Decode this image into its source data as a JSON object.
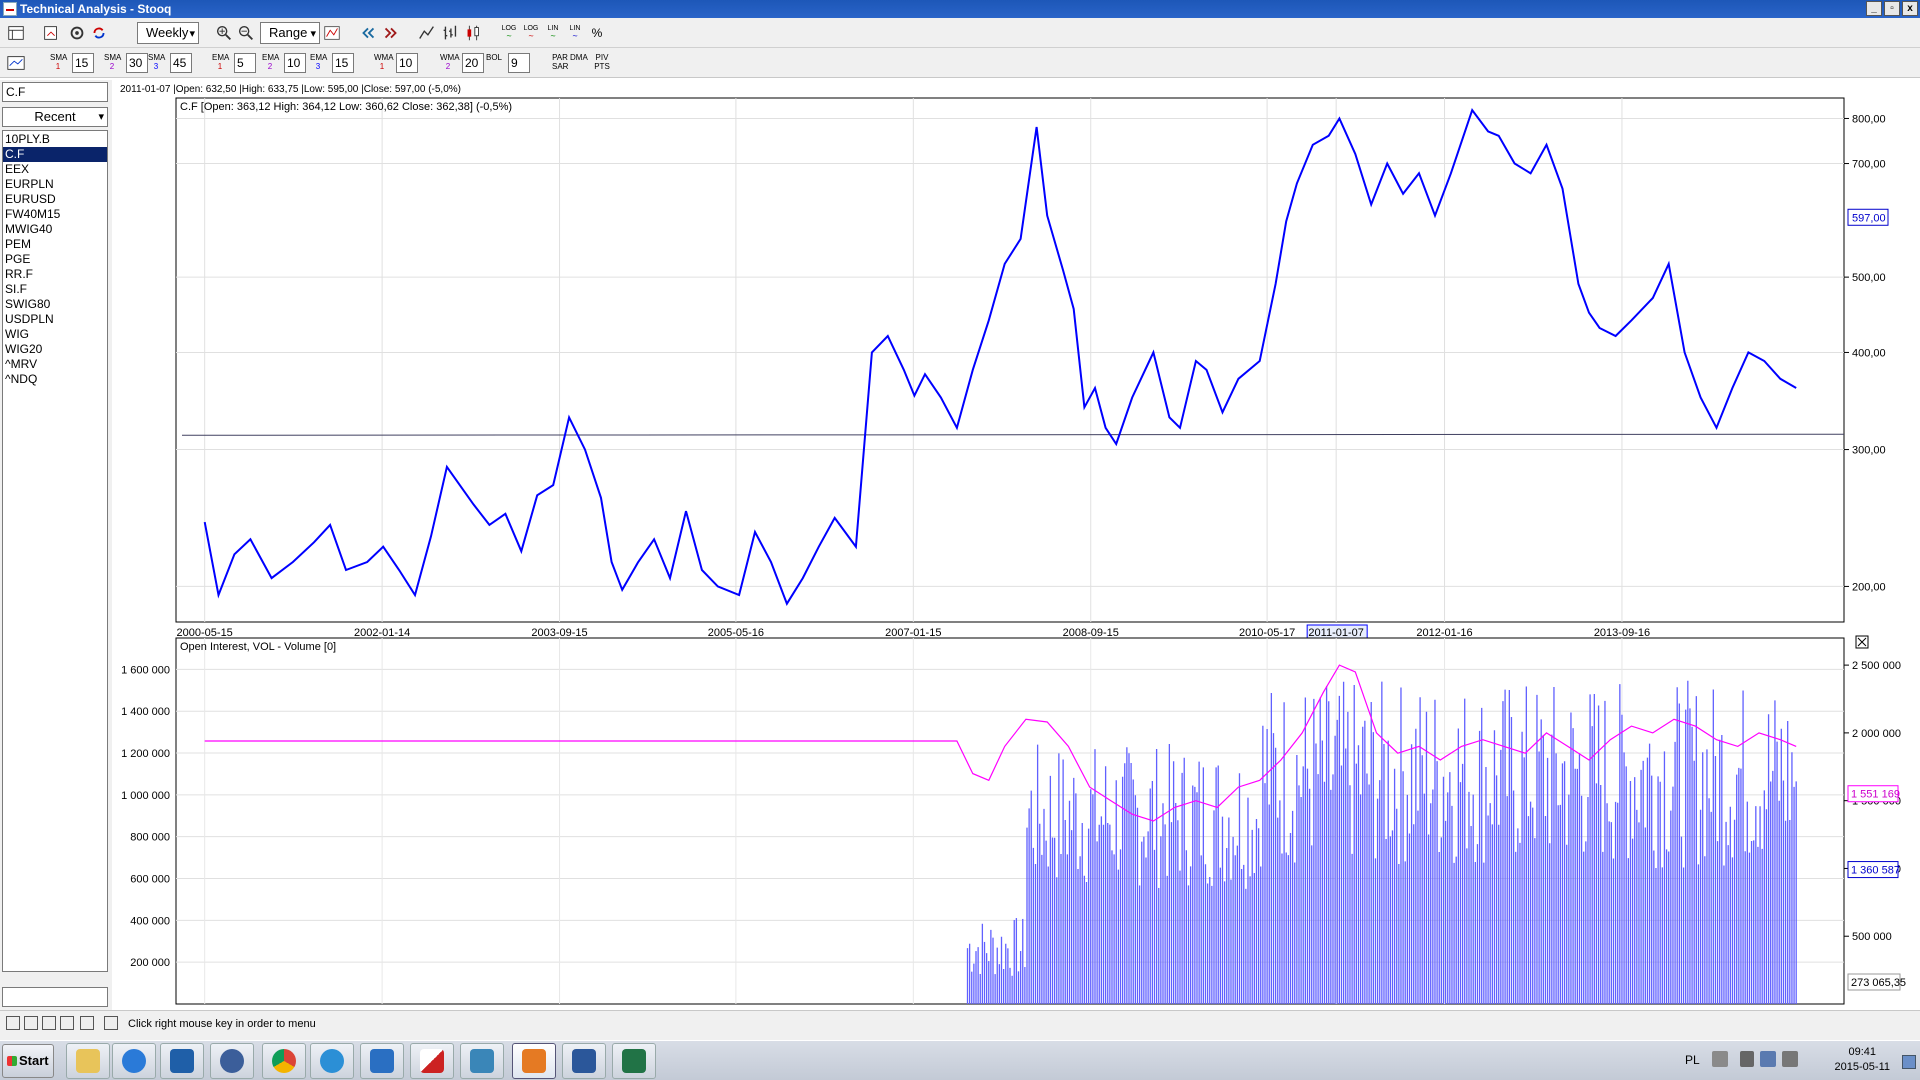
{
  "window": {
    "title": "Technical Analysis - Stooq",
    "buttons": [
      "_",
      "▫",
      "x"
    ]
  },
  "toolbar": {
    "interval": "Weekly",
    "range": "Range",
    "scale_buttons": [
      "LOG",
      "LOG",
      "LIN",
      "LIN",
      "%"
    ]
  },
  "indicators": [
    {
      "name": "SMA",
      "index": "1",
      "value": "15",
      "color": "#cc0000"
    },
    {
      "name": "SMA",
      "index": "2",
      "value": "30",
      "color": "#9900cc"
    },
    {
      "name": "SMA",
      "index": "3",
      "value": "45",
      "color": "#0000ff"
    },
    {
      "name": "EMA",
      "index": "1",
      "value": "5",
      "color": "#cc0000"
    },
    {
      "name": "EMA",
      "index": "2",
      "value": "10",
      "color": "#9900cc"
    },
    {
      "name": "EMA",
      "index": "3",
      "value": "15",
      "color": "#0000ff"
    },
    {
      "name": "WMA",
      "index": "1",
      "value": "10",
      "color": "#cc0000"
    },
    {
      "name": "WMA",
      "index": "2",
      "value": "20",
      "color": "#9900cc"
    },
    {
      "name": "BOL",
      "index": "",
      "value": "9",
      "color": "#000000"
    },
    {
      "name": "PAR SAR",
      "index": "",
      "value": "",
      "color": "#000000"
    },
    {
      "name": "DMA",
      "index": "",
      "value": "",
      "color": "#000000"
    },
    {
      "name": "PIV PTS",
      "index": "",
      "value": "",
      "color": "#000000"
    }
  ],
  "sidebar": {
    "symbol": "C.F",
    "recent": "Recent",
    "symbols": [
      "10PLY.B",
      "C.F",
      "EEX",
      "EURPLN",
      "EURUSD",
      "FW40M15",
      "MWIG40",
      "PEM",
      "PGE",
      "RR.F",
      "SI.F",
      "SWIG80",
      "USDPLN",
      "WIG",
      "WIG20",
      "^MRV",
      "^NDQ"
    ],
    "selected": "C.F"
  },
  "infoline": "2011-01-07 |Open: 632,50 |High: 633,75 |Low: 595,00 |Close: 597,00 (-5,0%)",
  "chart_data": [
    {
      "type": "line",
      "title": "C.F [Open: 363,12  High: 364,12  Low: 360,62  Close: 362,38] (-0,5%)",
      "y_scale": "log",
      "ylim": [
        180,
        850
      ],
      "y_ticks": [
        "800,00",
        "700,00",
        "500,00",
        "400,00",
        "300,00",
        "200,00"
      ],
      "y_tick_values": [
        800,
        700,
        500,
        400,
        300,
        200
      ],
      "current_value": "597,00",
      "x_ticks": [
        "2000-05-15",
        "2002-01-14",
        "2003-09-15",
        "2005-05-16",
        "2007-01-15",
        "2008-09-15",
        "2010-05-17",
        "2011-01-07",
        "2012-01-16",
        "2013-09-16"
      ],
      "x_tick_values": [
        2000.37,
        2002.04,
        2003.71,
        2005.37,
        2007.04,
        2008.71,
        2010.37,
        2011.02,
        2012.04,
        2013.71
      ],
      "highlighted_x": "2011-01-07",
      "xlim": [
        2000.1,
        2015.8
      ],
      "horizontal_line": 313,
      "series": [
        {
          "color": "#0000ff",
          "x": [
            2000.37,
            2000.5,
            2000.65,
            2000.8,
            2001.0,
            2001.2,
            2001.4,
            2001.55,
            2001.7,
            2001.9,
            2002.05,
            2002.2,
            2002.35,
            2002.5,
            2002.65,
            2002.9,
            2003.05,
            2003.2,
            2003.35,
            2003.5,
            2003.65,
            2003.8,
            2003.95,
            2004.1,
            2004.2,
            2004.3,
            2004.45,
            2004.6,
            2004.75,
            2004.9,
            2005.05,
            2005.2,
            2005.4,
            2005.55,
            2005.7,
            2005.85,
            2006.0,
            2006.15,
            2006.3,
            2006.5,
            2006.65,
            2006.8,
            2006.95,
            2007.05,
            2007.15,
            2007.3,
            2007.45,
            2007.6,
            2007.75,
            2007.9,
            2008.05,
            2008.2,
            2008.3,
            2008.45,
            2008.55,
            2008.65,
            2008.75,
            2008.85,
            2008.95,
            2009.1,
            2009.3,
            2009.45,
            2009.55,
            2009.7,
            2009.8,
            2009.95,
            2010.1,
            2010.3,
            2010.45,
            2010.55,
            2010.65,
            2010.8,
            2010.95,
            2011.05,
            2011.2,
            2011.35,
            2011.5,
            2011.65,
            2011.8,
            2011.95,
            2012.1,
            2012.3,
            2012.45,
            2012.55,
            2012.7,
            2012.85,
            2013.0,
            2013.15,
            2013.3,
            2013.4,
            2013.5,
            2013.65,
            2013.8,
            2014.0,
            2014.15,
            2014.3,
            2014.45,
            2014.6,
            2014.75,
            2014.9,
            2015.05,
            2015.2,
            2015.35
          ],
          "y": [
            242,
            195,
            220,
            230,
            205,
            215,
            228,
            240,
            210,
            215,
            225,
            210,
            195,
            232,
            285,
            255,
            240,
            248,
            222,
            262,
            270,
            330,
            300,
            260,
            215,
            198,
            215,
            230,
            205,
            250,
            210,
            200,
            195,
            235,
            215,
            190,
            205,
            225,
            245,
            225,
            400,
            420,
            380,
            352,
            375,
            350,
            320,
            380,
            440,
            520,
            560,
            780,
            600,
            510,
            455,
            340,
            360,
            320,
            305,
            350,
            400,
            330,
            320,
            390,
            380,
            335,
            370,
            390,
            490,
            590,
            660,
            740,
            760,
            800,
            720,
            620,
            700,
            640,
            680,
            600,
            680,
            820,
            770,
            760,
            700,
            680,
            740,
            650,
            490,
            450,
            430,
            420,
            440,
            470,
            520,
            400,
            350,
            320,
            360,
            400,
            390,
            370,
            360
          ]
        }
      ]
    },
    {
      "type": "bar",
      "title": "Open Interest, VOL - Volume [0]",
      "y_ticks": [
        "1 600 000",
        "1 400 000",
        "1 200 000",
        "1 000 000",
        "800 000",
        "600 000",
        "400 000",
        "200 000"
      ],
      "y_tick_values": [
        1600000,
        1400000,
        1200000,
        1000000,
        800000,
        600000,
        400000,
        200000
      ],
      "ylim": [
        0,
        1750000
      ],
      "right_ticks": [
        "2 500 000",
        "2 000 000",
        "1 500 000",
        "1 000 000",
        "500 000"
      ],
      "right_tick_values": [
        2500000,
        2000000,
        1500000,
        1000000,
        500000
      ],
      "right_ylim": [
        0,
        2700000
      ],
      "label_oi": "1 551 169",
      "label_vol": "1 360 587",
      "label_bottom": "273 065,35",
      "series": [
        {
          "name": "Open Interest",
          "color": "#ff00ff",
          "x": [
            2000.37,
            2001,
            2002,
            2003,
            2004,
            2005,
            2006,
            2007,
            2007.45,
            2007.6,
            2007.75,
            2007.9,
            2008.1,
            2008.3,
            2008.5,
            2008.7,
            2008.9,
            2009.1,
            2009.3,
            2009.5,
            2009.7,
            2009.9,
            2010.1,
            2010.3,
            2010.5,
            2010.7,
            2010.9,
            2011.05,
            2011.2,
            2011.4,
            2011.6,
            2011.8,
            2012.0,
            2012.2,
            2012.4,
            2012.6,
            2012.8,
            2013.0,
            2013.2,
            2013.4,
            2013.6,
            2013.8,
            2014.0,
            2014.2,
            2014.4,
            2014.6,
            2014.8,
            2015.0,
            2015.2,
            2015.35
          ],
          "y": [
            1940000,
            1940000,
            1940000,
            1940000,
            1940000,
            1940000,
            1940000,
            1940000,
            1940000,
            1700000,
            1650000,
            1900000,
            2100000,
            2080000,
            1900000,
            1600000,
            1500000,
            1400000,
            1350000,
            1450000,
            1500000,
            1450000,
            1600000,
            1650000,
            1800000,
            2000000,
            2300000,
            2500000,
            2450000,
            2000000,
            1850000,
            1900000,
            1800000,
            1900000,
            1950000,
            1900000,
            1850000,
            2000000,
            1900000,
            1800000,
            1950000,
            2050000,
            2000000,
            2100000,
            2050000,
            1950000,
            1900000,
            2000000,
            1950000,
            1900000
          ]
        },
        {
          "name": "VOL",
          "color": "#4040ff"
        }
      ]
    }
  ],
  "status": {
    "text": "Click right mouse key in order to menu"
  },
  "taskbar": {
    "start": "Start",
    "apps": [
      "explorer",
      "media-player",
      "outlook",
      "swan",
      "chrome",
      "internet-explorer",
      "lync",
      "k-app",
      "navigation",
      "java",
      "word",
      "excel"
    ],
    "lang": "PL",
    "time": "09:41",
    "date": "2015-05-11"
  }
}
